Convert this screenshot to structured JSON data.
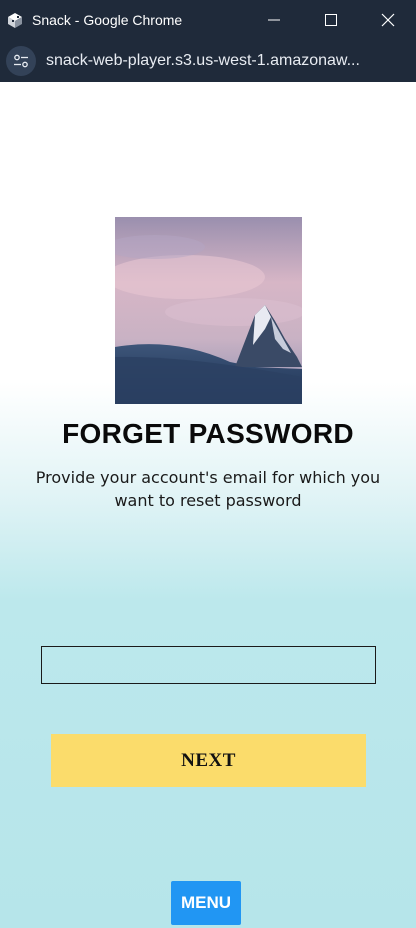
{
  "window": {
    "title": "Snack - Google Chrome",
    "app_icon": "snack-icon",
    "controls": [
      "minimize-icon",
      "maximize-icon",
      "close-icon"
    ]
  },
  "addressbar": {
    "site_info_icon": "site-settings-icon",
    "url": "snack-web-player.s3.us-west-1.amazonaw..."
  },
  "page": {
    "hero_image": "mountain-peak-at-dusk",
    "heading": "FORGET PASSWORD",
    "subtext": "Provide your account's email for which you want to reset password",
    "email_input": {
      "value": "",
      "placeholder": ""
    },
    "next_label": "NEXT",
    "menu_label": "MENU"
  },
  "colors": {
    "next_button": "#fbdc6b",
    "menu_button": "#2196f3",
    "background_bottom": "#b6e5ea"
  }
}
